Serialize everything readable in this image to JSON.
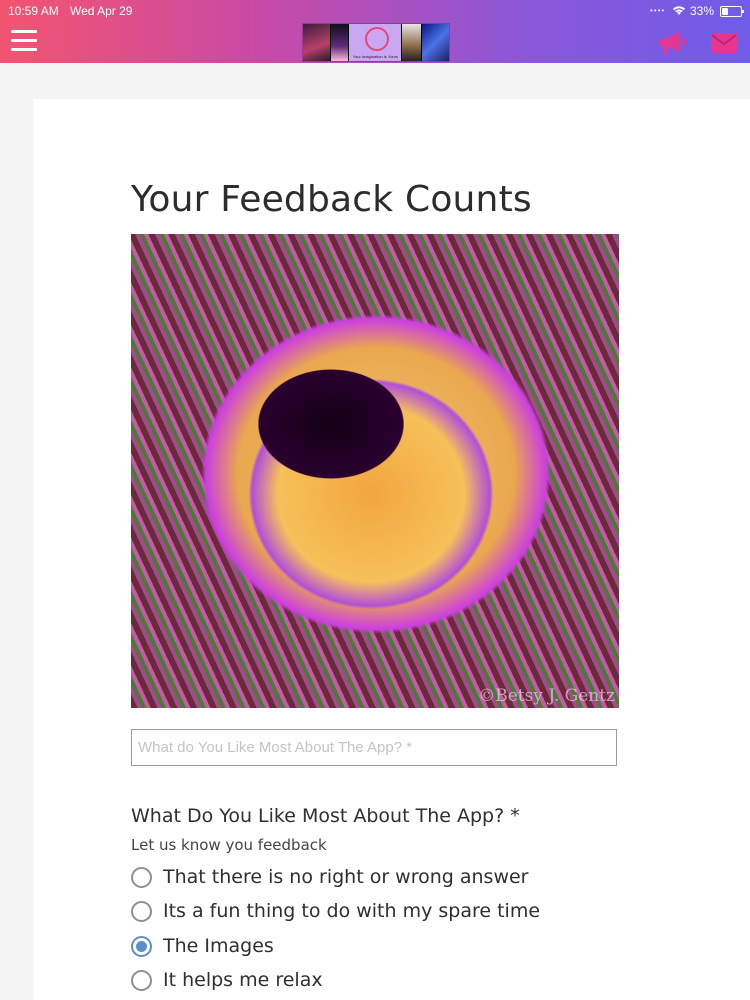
{
  "status_bar": {
    "time": "10:59 AM",
    "date": "Wed Apr 29",
    "battery": "33%"
  },
  "header": {
    "logo_tagline": "Your Imagination Is Yours",
    "icons": [
      "menu-icon",
      "announcement-icon",
      "mail-icon"
    ],
    "gradient": [
      "#f2546f",
      "#c84aa6",
      "#8b57d9",
      "#6f5ce8"
    ]
  },
  "page": {
    "title": "Your Feedback Counts",
    "photo_credit": "©Betsy J. Gentz"
  },
  "form": {
    "input_placeholder": "What do You Like Most About The App? *",
    "question": "What Do You Like Most About The App? *",
    "hint": "Let us know you feedback",
    "options": [
      {
        "label": "That there is no right or wrong answer",
        "selected": false
      },
      {
        "label": "Its a fun thing to do with my spare time",
        "selected": false
      },
      {
        "label": "The Images",
        "selected": true
      },
      {
        "label": "It helps me relax",
        "selected": false
      }
    ]
  },
  "colors": {
    "accent_radio": "#5b8fcb",
    "icon_pink": "#e8358f"
  }
}
